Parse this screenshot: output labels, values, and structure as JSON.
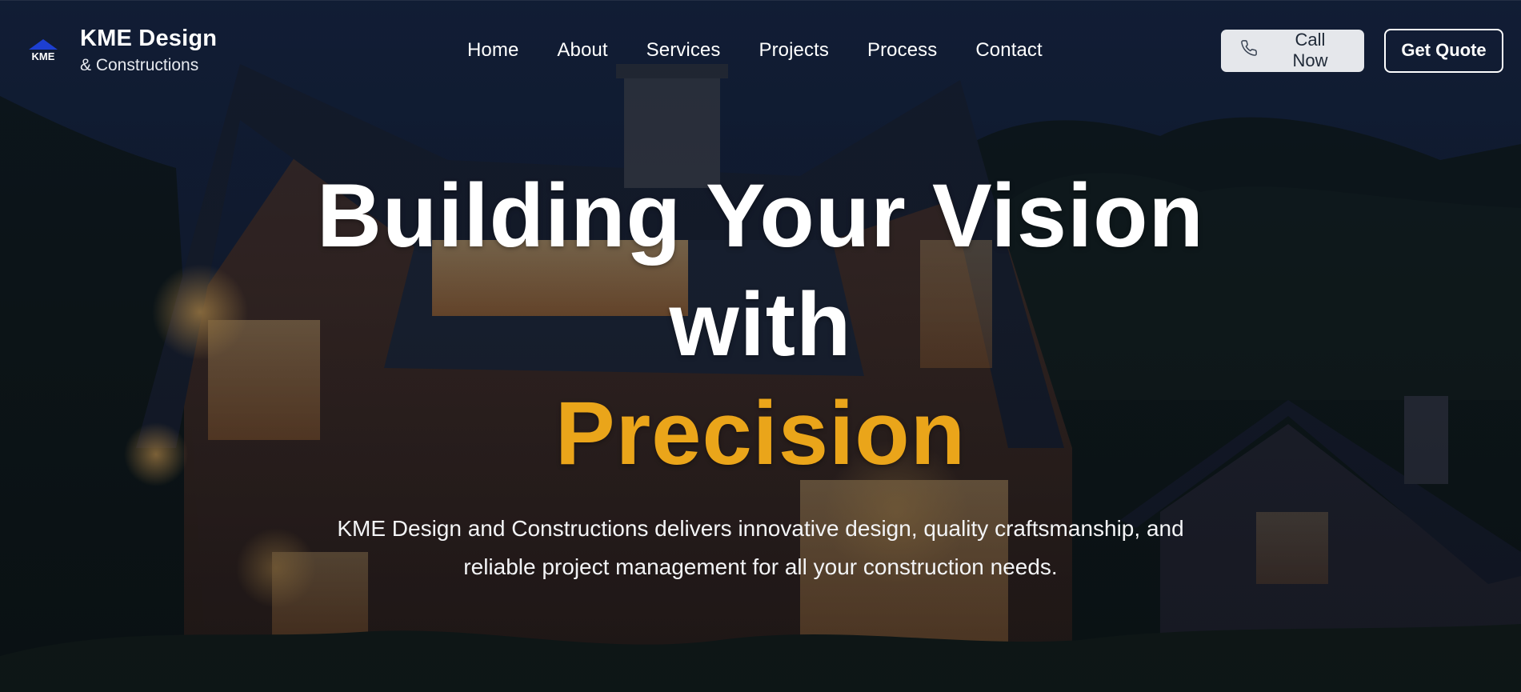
{
  "brand": {
    "name": "KME Design",
    "subtitle": "& Constructions",
    "logo_icon": "house-roof-logo-icon",
    "logo_text": "KME"
  },
  "nav": {
    "items": [
      {
        "label": "Home"
      },
      {
        "label": "About"
      },
      {
        "label": "Services"
      },
      {
        "label": "Projects"
      },
      {
        "label": "Process"
      },
      {
        "label": "Contact"
      }
    ]
  },
  "actions": {
    "call_label": "Call Now",
    "call_icon": "phone-icon",
    "quote_label": "Get Quote"
  },
  "hero": {
    "headline_line1": "Building Your Vision",
    "headline_line2": "with",
    "headline_accent": "Precision",
    "description_line1": "KME Design and Constructions delivers innovative design, quality craftsmanship, and",
    "description_line2": "reliable project management for all your construction needs."
  },
  "colors": {
    "accent": "#eaa51a",
    "text": "#ffffff",
    "call_button_bg": "#e5e7eb",
    "logo_blue": "#1d3fd1"
  }
}
